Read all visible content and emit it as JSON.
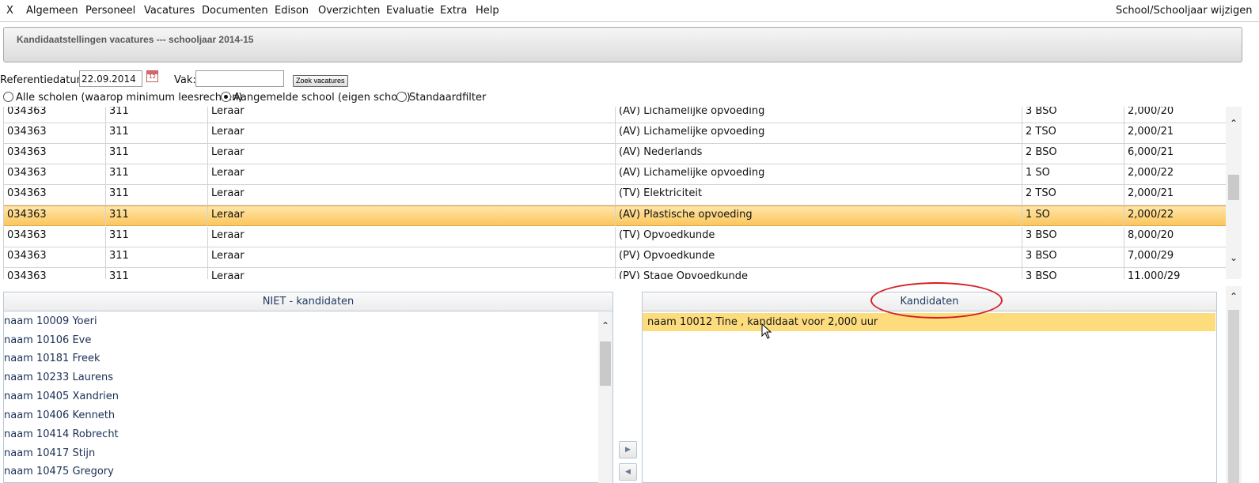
{
  "menu": {
    "close": "X",
    "items": [
      "Algemeen",
      "Personeel",
      "Vacatures",
      "Documenten",
      "Edison",
      "Overzichten",
      "Evaluatie",
      "Extra",
      "Help"
    ],
    "right": "School/Schooljaar wijzigen"
  },
  "header": {
    "title": "Kandidaatstellingen vacatures --- schooljaar 2014-15"
  },
  "filter": {
    "ref_label": "Referentiedatum:",
    "ref_value": "22.09.2014",
    "vak_label": "Vak:",
    "vak_value": "",
    "search_button": "Zoek vacatures",
    "radios": [
      {
        "label": "Alle scholen (waarop minimum leesrechten)",
        "checked": false
      },
      {
        "label": "Aangemelde school (eigen school)",
        "checked": true
      },
      {
        "label": "Standaardfilter",
        "checked": false
      }
    ]
  },
  "vacancies": [
    [
      "034363",
      "311",
      "Leraar",
      "(AV) Lichamelijke opvoeding",
      "3 BSO",
      "2,000/20"
    ],
    [
      "034363",
      "311",
      "Leraar",
      "(AV) Lichamelijke opvoeding",
      "2 TSO",
      "2,000/21"
    ],
    [
      "034363",
      "311",
      "Leraar",
      "(AV) Nederlands",
      "2 BSO",
      "6,000/21"
    ],
    [
      "034363",
      "311",
      "Leraar",
      "(AV) Lichamelijke opvoeding",
      "1 SO",
      "2,000/22"
    ],
    [
      "034363",
      "311",
      "Leraar",
      "(TV) Elektriciteit",
      "2 TSO",
      "2,000/21"
    ],
    [
      "034363",
      "311",
      "Leraar",
      "(AV) Plastische opvoeding",
      "1 SO",
      "2,000/22"
    ],
    [
      "034363",
      "311",
      "Leraar",
      "(TV) Opvoedkunde",
      "3 BSO",
      "8,000/20"
    ],
    [
      "034363",
      "311",
      "Leraar",
      "(PV) Opvoedkunde",
      "3 BSO",
      "7,000/29"
    ],
    [
      "034363",
      "311",
      "Leraar",
      "(PV) Stage Opvoedkunde",
      "3 BSO",
      "11,000/29"
    ]
  ],
  "selected_vacancy_index": 5,
  "niet_kandidaten": {
    "title": "NIET - kandidaten",
    "items": [
      "naam 10009 Yoeri",
      "naam 10106 Eve",
      "naam 10181 Freek",
      "naam 10233 Laurens",
      "naam 10405 Xandrien",
      "naam 10406 Kenneth",
      "naam 10414 Robrecht",
      "naam 10417 Stijn",
      "naam 10475 Gregory"
    ]
  },
  "kandidaten": {
    "title": "Kandidaten",
    "items": [
      "naam 10012 Tine , kandidaat voor 2,000 uur"
    ]
  },
  "colors": {
    "selected_row": "#fbc65d",
    "selected_candidate": "#fddc7e",
    "annotation": "#d42020",
    "panel_header_text": "#1f3b63"
  }
}
